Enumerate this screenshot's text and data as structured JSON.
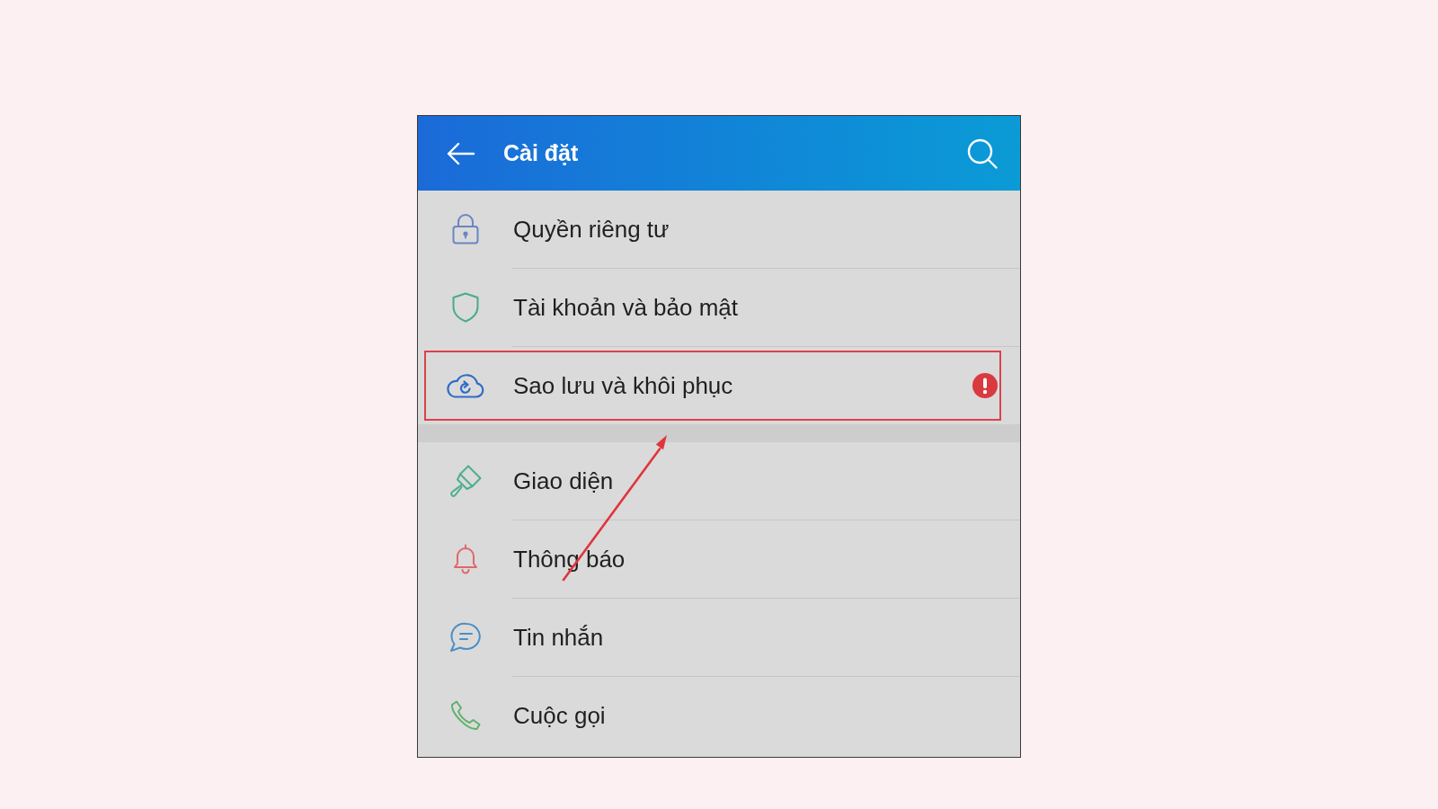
{
  "header": {
    "title": "Cài đặt"
  },
  "groups": [
    {
      "items": [
        {
          "label": "Quyền riêng tư",
          "highlighted": false,
          "alert": false
        },
        {
          "label": "Tài khoản và bảo mật",
          "highlighted": false,
          "alert": false
        },
        {
          "label": "Sao lưu và khôi phục",
          "highlighted": true,
          "alert": true
        }
      ]
    },
    {
      "items": [
        {
          "label": "Giao diện",
          "highlighted": false,
          "alert": false
        },
        {
          "label": "Thông báo",
          "highlighted": false,
          "alert": false
        },
        {
          "label": "Tin nhắn",
          "highlighted": false,
          "alert": false
        },
        {
          "label": "Cuộc gọi",
          "highlighted": false,
          "alert": false
        }
      ]
    }
  ]
}
